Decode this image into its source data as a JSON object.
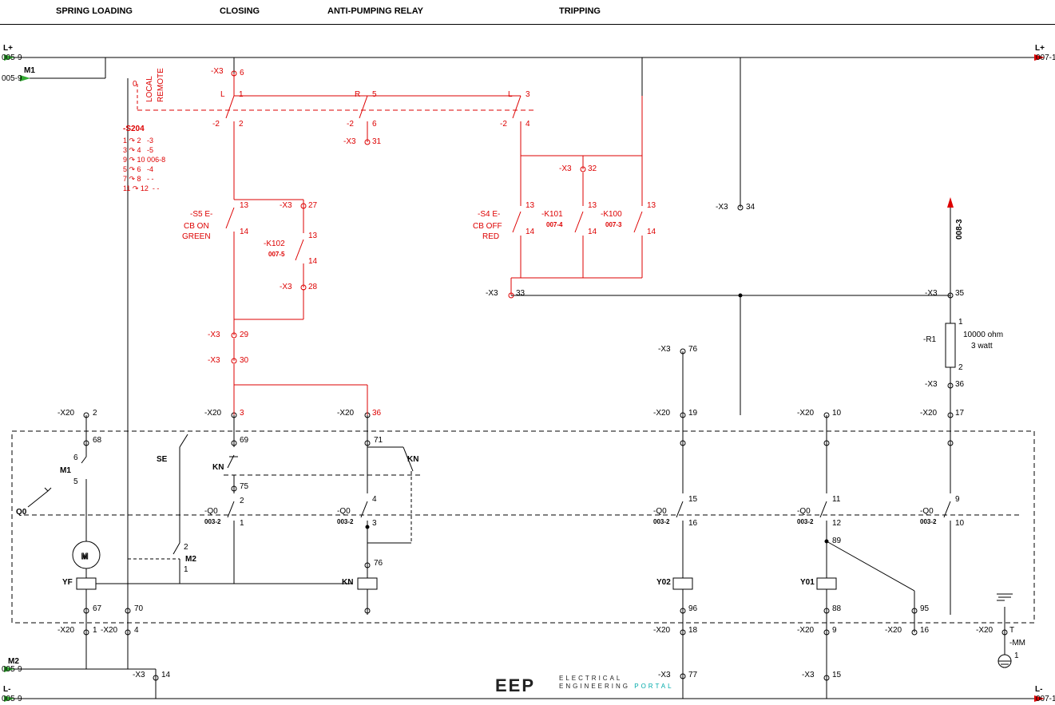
{
  "header": {
    "sec1": "SPRING LOADING",
    "sec2": "CLOSING",
    "sec3": "ANTI-PUMPING RELAY",
    "sec4": "TRIPPING"
  },
  "bus": {
    "lplus": "L+",
    "lminus": "L-",
    "m1": "M1",
    "m2": "M2",
    "refL": "005-9",
    "refR1": "007-1",
    "refR2": "007-1",
    "ref008": "008-3"
  },
  "s204": {
    "name": "-S204",
    "pos0": "0",
    "local": "LOCAL",
    "remote": "REMOTE",
    "rows": "1 ↷ 2   -3\n3 ↷ 4   -5\n9 ↷ 10 006-8\n5 ↷ 6   -4\n7 ↷ 8   - -\n11 ↷ 12  - -"
  },
  "sw": {
    "L1": "L",
    "R": "R",
    "L2": "L",
    "neg2a": "-2",
    "neg2b": "-2",
    "neg2c": "-2",
    "t1": "1",
    "t2": "2",
    "t5": "5",
    "t6": "6",
    "t3": "3",
    "t4": "4"
  },
  "x3": {
    "lbl": "-X3",
    "t6": "6",
    "t31": "31",
    "t27": "27",
    "t28": "28",
    "t29": "29",
    "t30": "30",
    "t32": "32",
    "t33": "33",
    "t34": "34",
    "t35": "35",
    "t36": "36",
    "t76": "76",
    "t77": "77",
    "t14": "14",
    "t15": "15"
  },
  "s5": {
    "name": "-S5 E-",
    "l1": "CB ON",
    "l2": "GREEN",
    "t13": "13",
    "t14": "14"
  },
  "s4": {
    "name": "-S4 E-",
    "l1": "CB OFF",
    "l2": "RED",
    "t13": "13",
    "t14": "14"
  },
  "k102": {
    "name": "-K102",
    "ref": "007-5",
    "t13": "13",
    "t14": "14"
  },
  "k101": {
    "name": "-K101",
    "ref": "007-4",
    "t13": "13",
    "t14": "14"
  },
  "k100": {
    "name": "-K100",
    "ref": "007-3",
    "t13": "13",
    "t14": "14"
  },
  "r1": {
    "name": "-R1",
    "val": "10000 ohm",
    "pw": "3 watt",
    "t1": "1",
    "t2": "2"
  },
  "x20": {
    "lbl": "-X20",
    "t1": "1",
    "t2": "2",
    "t3": "3",
    "t4": "4",
    "t9": "9",
    "t10": "10",
    "t16": "16",
    "t17": "17",
    "t18": "18",
    "t19": "19",
    "t36": "36",
    "tT": "T"
  },
  "inner": {
    "t67": "67",
    "t68": "68",
    "t69": "69",
    "t70": "70",
    "t71": "71",
    "t75": "75",
    "t76": "76",
    "t88": "88",
    "t89": "89",
    "t95": "95",
    "t96": "96",
    "m1": "M1",
    "m1t5": "5",
    "m1t6": "6",
    "m2": "M2",
    "m2t1": "1",
    "m2t2": "2",
    "se": "SE",
    "kn": "KN",
    "kn2": "KN",
    "q0": "Q0",
    "motor": "M",
    "yf": "YF",
    "y01": "Y01",
    "y02": "Y02",
    "q0ref": "003-2",
    "q0lbl": "-Q0",
    "tq1": "1",
    "tq2": "2",
    "tq3": "3",
    "tq4": "4",
    "tq9": "9",
    "tq10": "10",
    "tq11": "11",
    "tq12": "12",
    "tq15": "15",
    "tq16": "16"
  },
  "mm": {
    "name": "-MM",
    "t1": "1"
  },
  "brand": {
    "logo": "EEP",
    "l1": "ELECTRICAL",
    "l2": "ENGINEERING",
    "l3": "PORTAL"
  }
}
